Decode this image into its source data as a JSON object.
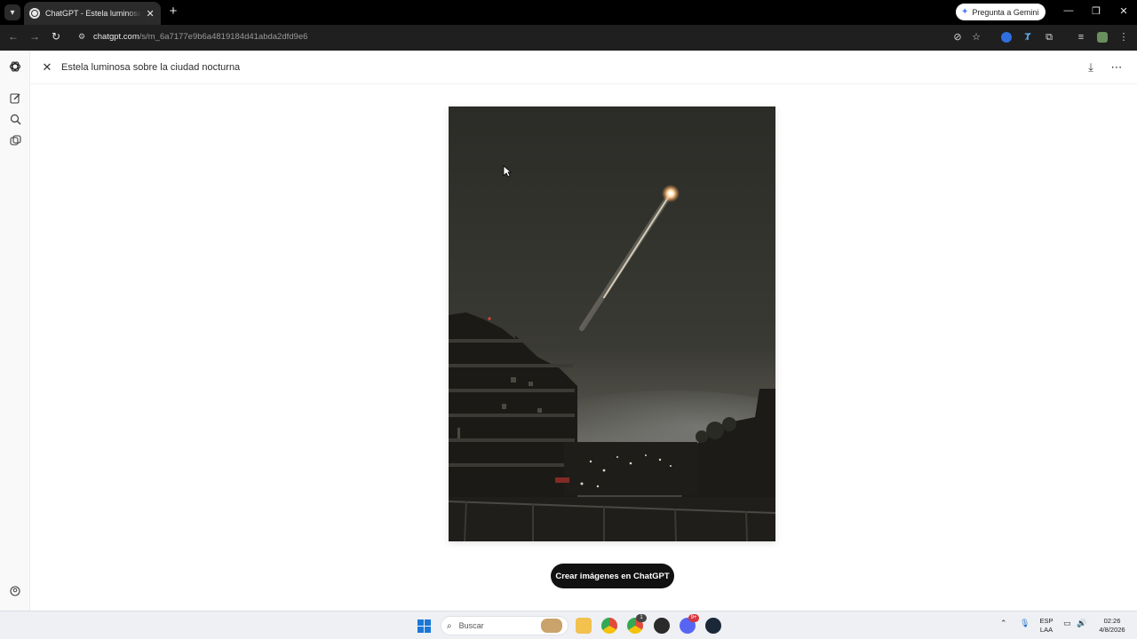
{
  "browser": {
    "tab_title": "ChatGPT - Estela luminosa sobre la ciudad nocturna",
    "gemini_label": "Pregunta a Gemini",
    "url_host": "chatgpt.com",
    "url_path": "/s/m_6a7177e9b6a4819184d41abda2dfd9e6"
  },
  "viewer": {
    "title": "Estela luminosa sobre la ciudad nocturna",
    "cta_label": "Crear imágenes en ChatGPT"
  },
  "taskbar": {
    "search_placeholder": "Buscar",
    "lang_top": "ESP",
    "lang_bottom": "LAA",
    "time": "02:26",
    "date": "4/8/2026",
    "chrome_badge": "1",
    "discord_badge": "9+"
  },
  "colors": {
    "tab_bg": "#2b2b2b",
    "toolbar_bg": "#1f1f1f",
    "cta_bg": "#111111",
    "sidebar_bg": "#f9f9f9",
    "taskbar_bg": "#eef0f4"
  },
  "icons": {
    "sidebar": [
      "chatgpt-logo-icon",
      "new-chat-icon",
      "search-icon",
      "images-icon",
      "profile-icon"
    ],
    "top_actions": [
      "download-icon",
      "more-options-icon"
    ]
  }
}
